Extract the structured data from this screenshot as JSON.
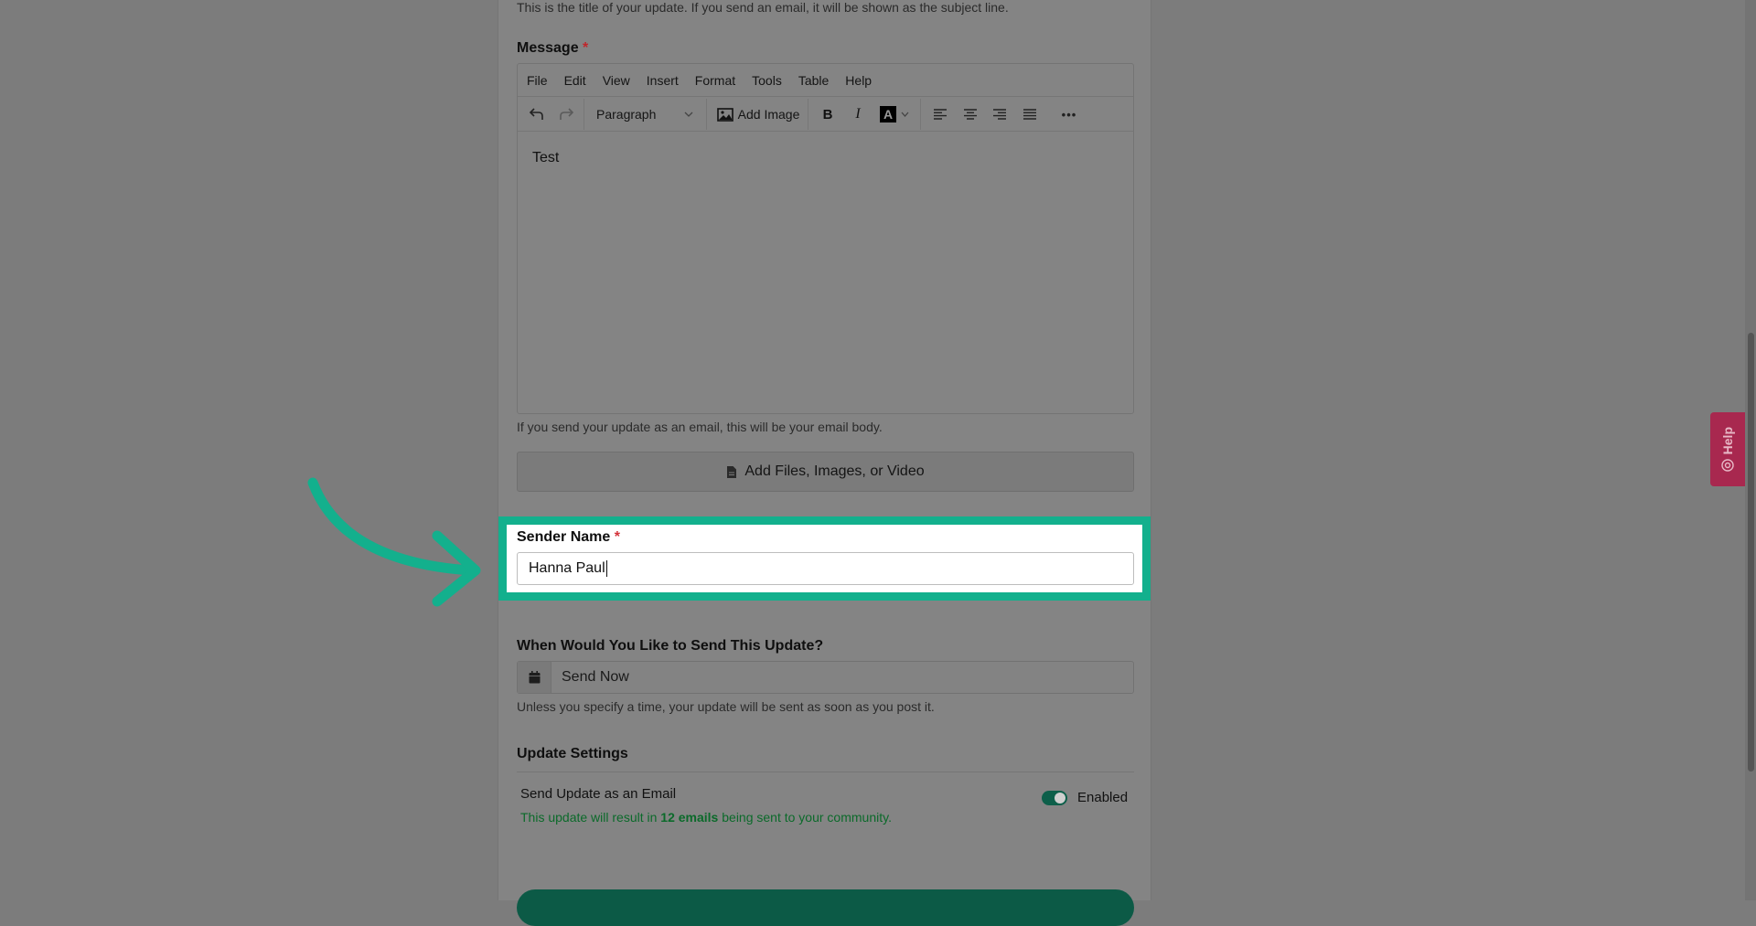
{
  "title_help": "This is the title of your update. If you send an email, it will be shown as the subject line.",
  "message": {
    "label": "Message",
    "required_mark": "*",
    "menu": [
      "File",
      "Edit",
      "View",
      "Insert",
      "Format",
      "Tools",
      "Table",
      "Help"
    ],
    "block_format": "Paragraph",
    "add_image_label": "Add Image",
    "bold_label": "B",
    "italic_label": "I",
    "font_color_label": "A",
    "more_label": "•••",
    "body_text": "Test",
    "help": "If you send your update as an email, this will be your email body."
  },
  "add_files_label": "Add Files, Images, or Video",
  "sender": {
    "label": "Sender Name",
    "required_mark": "*",
    "value": "Hanna Paul"
  },
  "schedule": {
    "label": "When Would You Like to Send This Update?",
    "value": "Send Now",
    "help": "Unless you specify a time, your update will be sent as soon as you post it."
  },
  "settings": {
    "heading": "Update Settings",
    "email_label": "Send Update as an Email",
    "toggle_state": "Enabled",
    "result_prefix": "This update will result in ",
    "result_count": "12 emails",
    "result_suffix": " being sent to your community."
  },
  "help_tab_label": "Help",
  "colors": {
    "highlight": "#13b08d",
    "toggle_on": "#0d5f4a",
    "help_tab": "#a8284f",
    "required": "#c0262b"
  }
}
